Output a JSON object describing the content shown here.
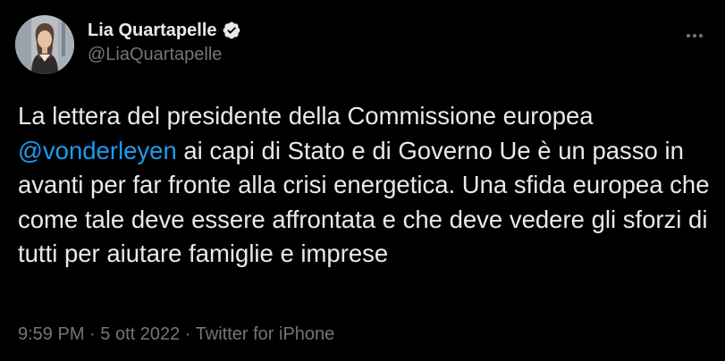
{
  "author": {
    "display_name": "Lia Quartapelle",
    "handle": "@LiaQuartapelle",
    "verified": true
  },
  "tweet": {
    "text_before": "La lettera del presidente della Commissione europea ",
    "mention": "@vonderleyen",
    "text_after": " ai capi di Stato e di Governo Ue è un passo in avanti per far fronte alla crisi energetica. Una sfida europea che come tale deve essere affrontata e che deve vedere gli sforzi di tutti per aiutare famiglie e imprese"
  },
  "meta": {
    "time": "9:59 PM",
    "separator": " · ",
    "date": "5 ott 2022",
    "source": "Twitter for iPhone"
  },
  "icons": {
    "verified": "verified-badge-icon",
    "more": "more-options-icon"
  },
  "colors": {
    "background": "#000000",
    "text": "#e7e9ea",
    "secondary": "#71767b",
    "accent": "#1d9bf0"
  }
}
